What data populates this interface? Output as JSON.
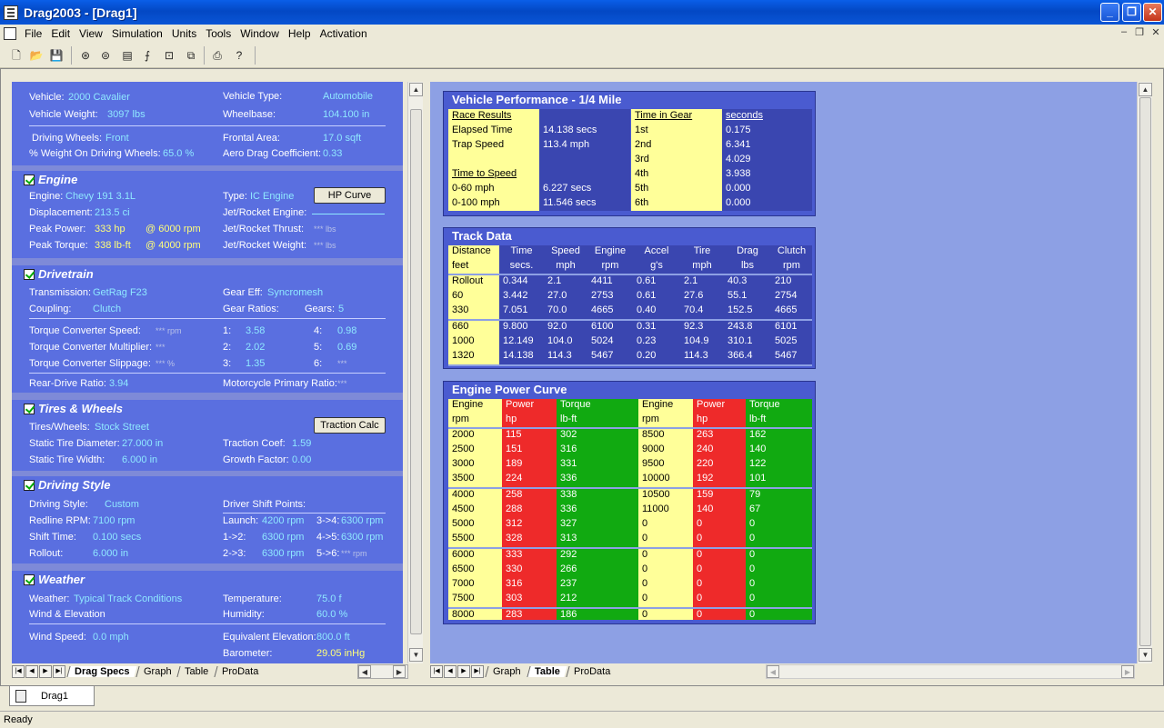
{
  "window": {
    "title": "Drag2003 - [Drag1]"
  },
  "menu": [
    "File",
    "Edit",
    "View",
    "Simulation",
    "Units",
    "Tools",
    "Window",
    "Help",
    "Activation"
  ],
  "specs": {
    "vehicle": {
      "vehicle_label": "Vehicle:",
      "vehicle": "2000 Cavalier",
      "type_label": "Vehicle Type:",
      "type": "Automobile",
      "weight_label": "Vehicle Weight:",
      "weight": "3097 lbs",
      "wheelbase_label": "Wheelbase:",
      "wheelbase": "104.100 in",
      "drive_label": "Driving Wheels:",
      "drive": "Front",
      "frontal_label": "Frontal Area:",
      "frontal": "17.0 sqft",
      "pct_label": "% Weight On Driving Wheels:",
      "pct": "65.0 %",
      "aero_label": "Aero Drag Coefficient:",
      "aero": "0.33"
    },
    "engine": {
      "title": "Engine",
      "engine_label": "Engine:",
      "engine": "Chevy 191 3.1L",
      "type_label": "Type:",
      "type": "IC Engine",
      "hp_button": "HP Curve",
      "disp_label": "Displacement:",
      "disp": "213.5 ci",
      "jet_label": "Jet/Rocket Engine:",
      "peak_power_label": "Peak Power:",
      "peak_power": "333 hp",
      "peak_power_rpm": "@ 6000 rpm",
      "thrust_label": "Jet/Rocket Thrust:",
      "thrust": "*** lbs",
      "peak_torque_label": "Peak Torque:",
      "peak_torque": "338 lb-ft",
      "peak_torque_rpm": "@ 4000 rpm",
      "jetweight_label": "Jet/Rocket Weight:",
      "jetweight": "*** lbs"
    },
    "drivetrain": {
      "title": "Drivetrain",
      "trans_label": "Transmission:",
      "trans": "GetRag F23",
      "geareff_label": "Gear Eff:",
      "geareff": "Syncromesh",
      "coupling_label": "Coupling:",
      "coupling": "Clutch",
      "ratios_label": "Gear Ratios:",
      "gears_label": "Gears:",
      "gears": "5",
      "tcs_label": "Torque Converter Speed:",
      "tcs": "*** rpm",
      "tcm_label": "Torque Converter Multiplier:",
      "tcm": "***",
      "tcsl_label": "Torque Converter Slippage:",
      "tcsl": "*** %",
      "g1": "1:",
      "r1": "3.58",
      "g2": "2:",
      "r2": "2.02",
      "g3": "3:",
      "r3": "1.35",
      "g4": "4:",
      "r4": "0.98",
      "g5": "5:",
      "r5": "0.69",
      "g6": "6:",
      "r6": "***",
      "rear_label": "Rear-Drive Ratio:",
      "rear": "3.94",
      "moto_label": "Motorcycle Primary Ratio:",
      "moto": "***"
    },
    "tires": {
      "title": "Tires & Wheels",
      "tires_label": "Tires/Wheels:",
      "tires": "Stock Street",
      "traction_button": "Traction Calc",
      "diam_label": "Static Tire Diameter:",
      "diam": "27.000 in",
      "coef_label": "Traction Coef:",
      "coef": "1.59",
      "width_label": "Static Tire Width:",
      "width": "6.000 in",
      "growth_label": "Growth Factor:",
      "growth": "0.00"
    },
    "style": {
      "title": "Driving Style",
      "style_label": "Driving Style:",
      "style": "Custom",
      "shift_label": "Driver Shift Points:",
      "redline_label": "Redline RPM:",
      "redline": "7100 rpm",
      "launch_label": "Launch:",
      "launch": "4200 rpm",
      "s34_label": "3->4:",
      "s34": "6300 rpm",
      "shifttime_label": "Shift Time:",
      "shifttime": "0.100 secs",
      "s12_label": "1->2:",
      "s12": "6300 rpm",
      "s45_label": "4->5:",
      "s45": "6300 rpm",
      "rollout_label": "Rollout:",
      "rollout": "6.000 in",
      "s23_label": "2->3:",
      "s23": "6300 rpm",
      "s56_label": "5->6:",
      "s56": "*** rpm"
    },
    "weather": {
      "title": "Weather",
      "weather_label": "Weather:",
      "weather": "Typical Track Conditions",
      "temp_label": "Temperature:",
      "temp": "75.0 f",
      "wind_elev_label": "Wind & Elevation",
      "humidity_label": "Humidity:",
      "humidity": "60.0 %",
      "windspeed_label": "Wind Speed:",
      "windspeed": "0.0 mph",
      "equiv_label": "Equivalent Elevation:",
      "equiv": "800.0 ft",
      "baro_label": "Barometer:",
      "baro": "29.05 inHg"
    }
  },
  "left_tabs": [
    "Drag Specs",
    "Graph",
    "Table",
    "ProData"
  ],
  "right_tabs": [
    "Graph",
    "Table",
    "ProData"
  ],
  "perf": {
    "title": "Vehicle Performance - 1/4 Mile",
    "col1": [
      "Race Results",
      "Elapsed Time",
      "Trap Speed",
      "",
      "Time to Speed",
      "0-60 mph",
      "0-100 mph"
    ],
    "col2": [
      "",
      "14.138 secs",
      "113.4 mph",
      "",
      "",
      "6.227 secs",
      "11.546 secs"
    ],
    "col3": [
      "Time in Gear",
      "1st",
      "2nd",
      "3rd",
      "4th",
      "5th",
      "6th"
    ],
    "col4": [
      "seconds",
      "0.175",
      "6.341",
      "4.029",
      "3.938",
      "0.000",
      "0.000"
    ]
  },
  "track": {
    "title": "Track Data",
    "headers": [
      [
        "Distance",
        "feet"
      ],
      [
        "Time",
        "secs."
      ],
      [
        "Speed",
        "mph"
      ],
      [
        "Engine",
        "rpm"
      ],
      [
        "Accel",
        "g's"
      ],
      [
        "Tire",
        "mph"
      ],
      [
        "Drag",
        "lbs"
      ],
      [
        "Clutch",
        "rpm"
      ]
    ],
    "rows": [
      [
        "Rollout",
        "0.344",
        "2.1",
        "4411",
        "0.61",
        "2.1",
        "40.3",
        "210"
      ],
      [
        "60",
        "3.442",
        "27.0",
        "2753",
        "0.61",
        "27.6",
        "55.1",
        "2754"
      ],
      [
        "330",
        "7.051",
        "70.0",
        "4665",
        "0.40",
        "70.4",
        "152.5",
        "4665"
      ],
      [
        "660",
        "9.800",
        "92.0",
        "6100",
        "0.31",
        "92.3",
        "243.8",
        "6101"
      ],
      [
        "1000",
        "12.149",
        "104.0",
        "5024",
        "0.23",
        "104.9",
        "310.1",
        "5025"
      ],
      [
        "1320",
        "14.138",
        "114.3",
        "5467",
        "0.20",
        "114.3",
        "366.4",
        "5467"
      ]
    ]
  },
  "power": {
    "title": "Engine Power Curve",
    "headers": [
      [
        "Engine",
        "rpm"
      ],
      [
        "Power",
        "hp"
      ],
      [
        "Torque",
        "lb-ft"
      ],
      [
        "Engine",
        "rpm"
      ],
      [
        "Power",
        "hp"
      ],
      [
        "Torque",
        "lb-ft"
      ]
    ],
    "rows": [
      [
        "2000",
        "115",
        "302",
        "8500",
        "263",
        "162"
      ],
      [
        "2500",
        "151",
        "316",
        "9000",
        "240",
        "140"
      ],
      [
        "3000",
        "189",
        "331",
        "9500",
        "220",
        "122"
      ],
      [
        "3500",
        "224",
        "336",
        "10000",
        "192",
        "101"
      ],
      [
        "4000",
        "258",
        "338",
        "10500",
        "159",
        "79"
      ],
      [
        "4500",
        "288",
        "336",
        "11000",
        "140",
        "67"
      ],
      [
        "5000",
        "312",
        "327",
        "0",
        "0",
        "0"
      ],
      [
        "5500",
        "328",
        "313",
        "0",
        "0",
        "0"
      ],
      [
        "6000",
        "333",
        "292",
        "0",
        "0",
        "0"
      ],
      [
        "6500",
        "330",
        "266",
        "0",
        "0",
        "0"
      ],
      [
        "7000",
        "316",
        "237",
        "0",
        "0",
        "0"
      ],
      [
        "7500",
        "303",
        "212",
        "0",
        "0",
        "0"
      ],
      [
        "8000",
        "283",
        "186",
        "0",
        "0",
        "0"
      ]
    ]
  },
  "doc_tab": "Drag1",
  "status": "Ready",
  "colors": {
    "panel": "#4a5bd0",
    "yellow": "#ffff99",
    "red": "#ee2a2a",
    "green": "#11aa11",
    "value_cyan": "#8fe8ff"
  }
}
